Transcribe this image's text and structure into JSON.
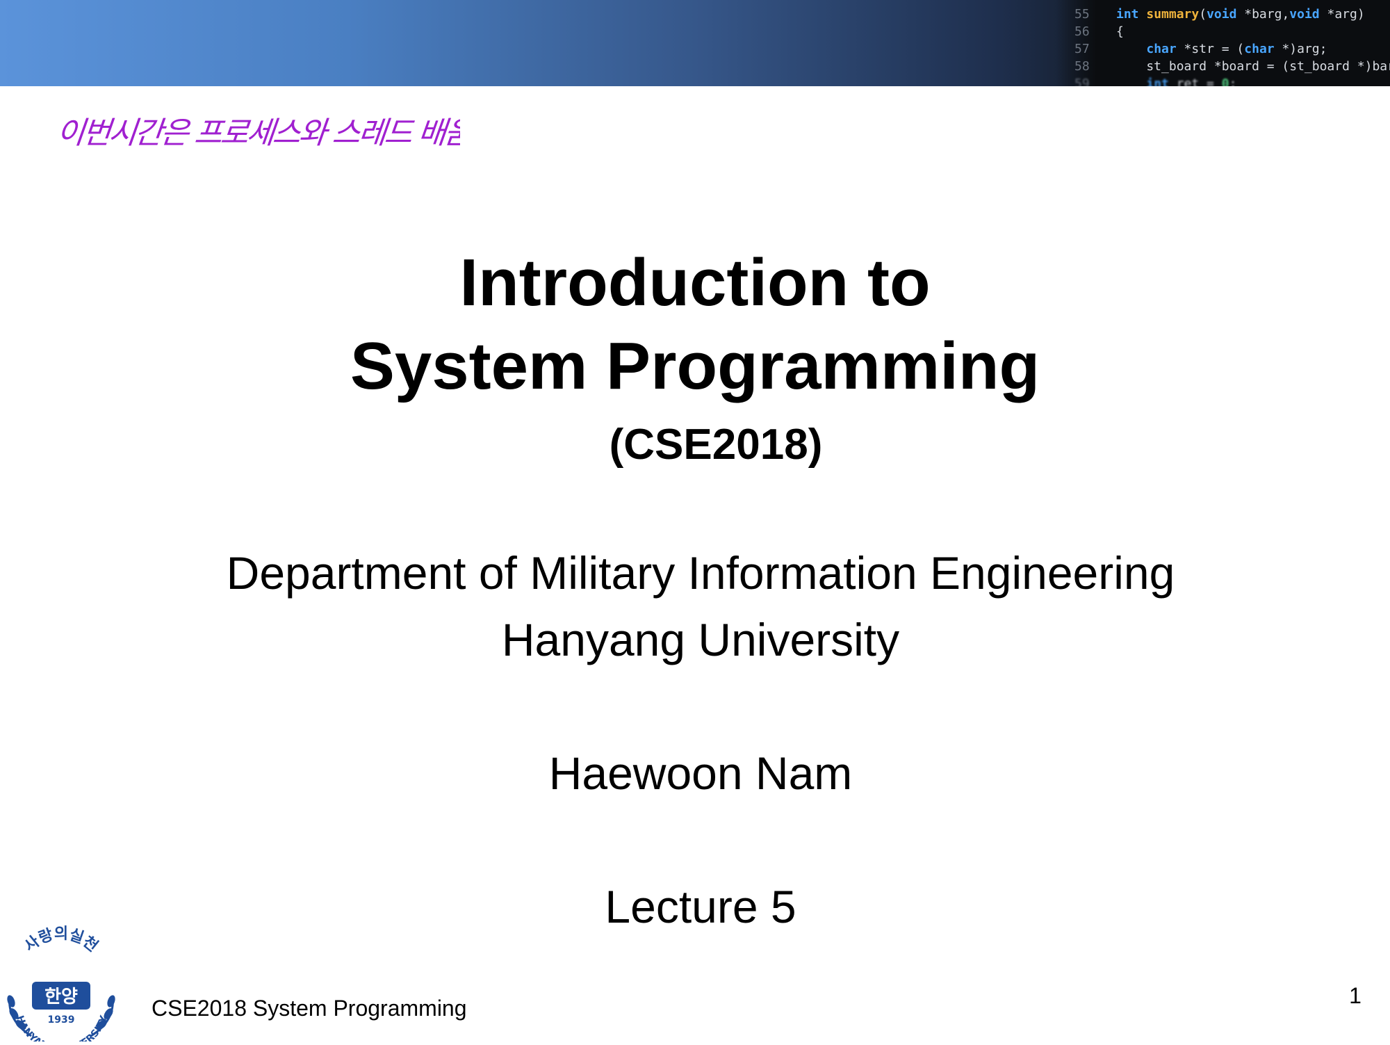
{
  "banner": {
    "code_lines": [
      {
        "num": "55",
        "parts": [
          [
            "kw",
            "int"
          ],
          [
            "t",
            " "
          ],
          [
            "fn",
            "summary"
          ],
          [
            "t",
            "("
          ],
          [
            "kw",
            "void"
          ],
          [
            "t",
            " *barg,"
          ],
          [
            "kw",
            "void"
          ],
          [
            "t",
            " *arg)"
          ]
        ]
      },
      {
        "num": "56",
        "parts": [
          [
            "t",
            "{"
          ]
        ]
      },
      {
        "num": "57",
        "parts": [
          [
            "t",
            "    "
          ],
          [
            "kw",
            "char"
          ],
          [
            "t",
            " *str = ("
          ],
          [
            "kw",
            "char"
          ],
          [
            "t",
            " *)arg;"
          ]
        ]
      },
      {
        "num": "58",
        "parts": [
          [
            "t",
            "    st_board *board = (st_board *)bar"
          ]
        ]
      },
      {
        "num": "59",
        "parts": [
          [
            "t",
            "    "
          ],
          [
            "kw",
            "int"
          ],
          [
            "t",
            " ret = "
          ],
          [
            "nm",
            "0"
          ],
          [
            "t",
            ";"
          ]
        ]
      }
    ]
  },
  "annotation": {
    "handwritten_note": "이번시간은 프로세스와 스레드 배움.",
    "color": "#a020d0"
  },
  "slide": {
    "title_line1": "Introduction to",
    "title_line2": "System Programming",
    "course_code": "(CSE2018)",
    "department": "Department of Military Information Engineering",
    "university": "Hanyang University",
    "author": "Haewoon Nam",
    "lecture": "Lecture 5"
  },
  "footer": {
    "course_label": "CSE2018 System Programming",
    "page_number": "1"
  },
  "seal": {
    "top_text": "사랑의실천",
    "center_text": "한양",
    "year": "1939",
    "bottom_text": "HANYANG UNIVERSITY",
    "color": "#1f4e9c"
  }
}
